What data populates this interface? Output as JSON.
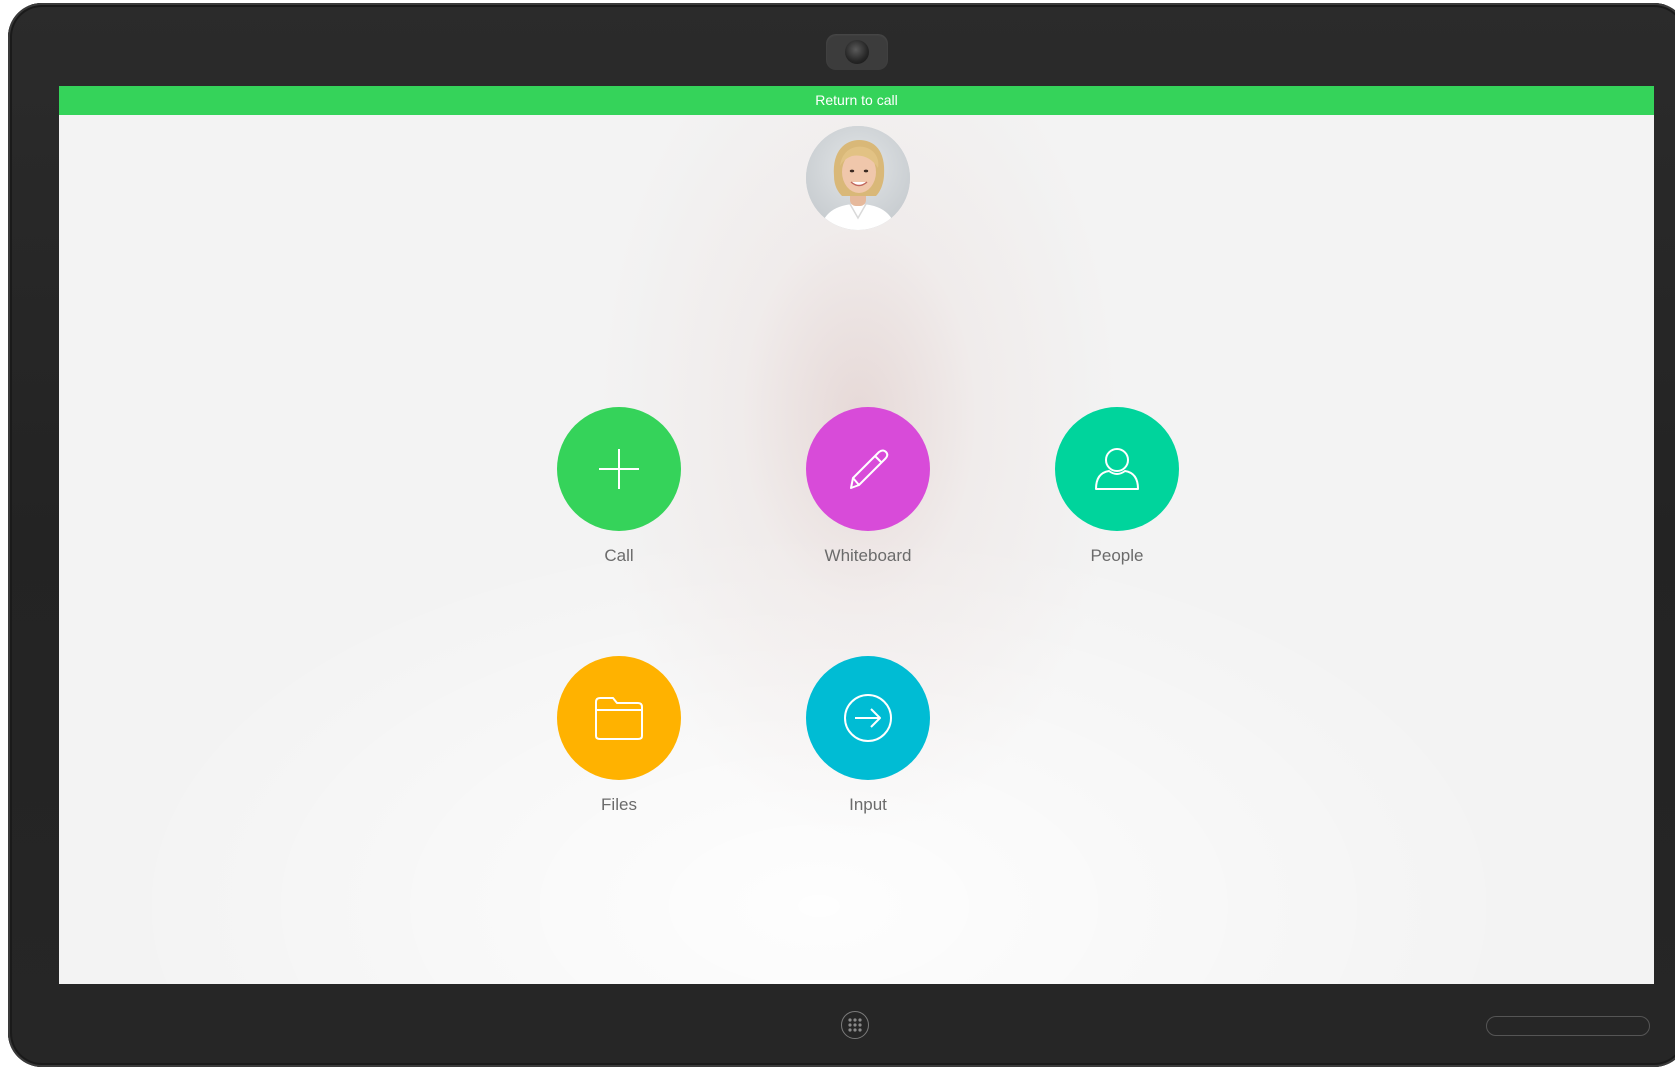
{
  "return_bar": {
    "label": "Return to call",
    "color": "#35d35a"
  },
  "avatar": {
    "description": "caller-photo"
  },
  "tiles": [
    {
      "label": "Call",
      "icon": "plus-icon",
      "color": "#35d35a"
    },
    {
      "label": "Whiteboard",
      "icon": "pencil-icon",
      "color": "#d84bd9"
    },
    {
      "label": "People",
      "icon": "person-icon",
      "color": "#00d49c"
    },
    {
      "label": "Files",
      "icon": "folder-icon",
      "color": "#ffb200"
    },
    {
      "label": "Input",
      "icon": "arrow-circle-icon",
      "color": "#00bcd4"
    }
  ],
  "device": {
    "home_button_icon": "grid-icon"
  }
}
